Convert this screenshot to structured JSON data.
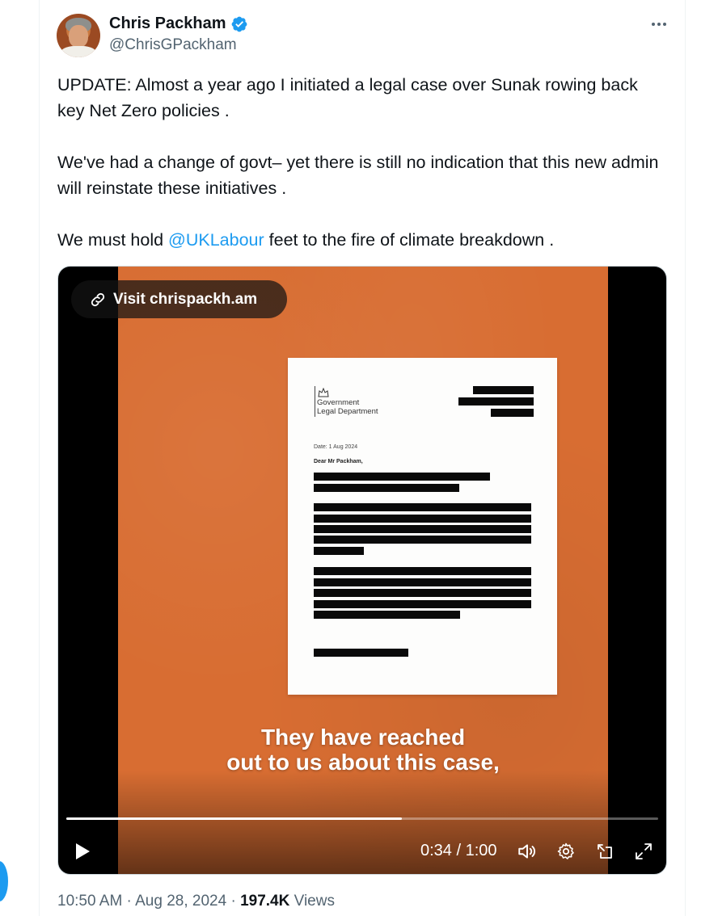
{
  "author": {
    "name": "Chris Packham",
    "handle": "@ChrisGPackham",
    "verified": true
  },
  "tweet": {
    "para1": "UPDATE: Almost a year ago I initiated a legal case over Sunak rowing back key Net Zero policies .",
    "para2": "We've had a change of govt– yet there is still no indication that this new admin will reinstate these initiatives .",
    "para3_before": "We must hold ",
    "para3_mention": "@UKLabour",
    "para3_after": " feet to the fire of climate breakdown ."
  },
  "video": {
    "visit_link": "Visit chrispackh.am",
    "letter": {
      "org_line1": "Government",
      "org_line2": "Legal Department",
      "date": "Date: 1 Aug 2024",
      "salutation": "Dear Mr Packham,"
    },
    "caption_line1": "They have reached",
    "caption_line2": "out to us about this case,",
    "time": "0:34 / 1:00",
    "progress_fraction": 0.5667,
    "accent_color": "#d86d32"
  },
  "footer": {
    "time": "10:50 AM",
    "sep1": " · ",
    "date": "Aug 28, 2024",
    "sep2": " · ",
    "views_count": "197.4K",
    "views_label": " Views"
  },
  "colors": {
    "link": "#1d9bf0",
    "secondary_text": "#536471"
  },
  "icons": [
    "verified-badge-icon",
    "more-icon",
    "link-icon",
    "play-icon",
    "volume-icon",
    "settings-icon",
    "picture-in-picture-icon",
    "fullscreen-icon"
  ]
}
